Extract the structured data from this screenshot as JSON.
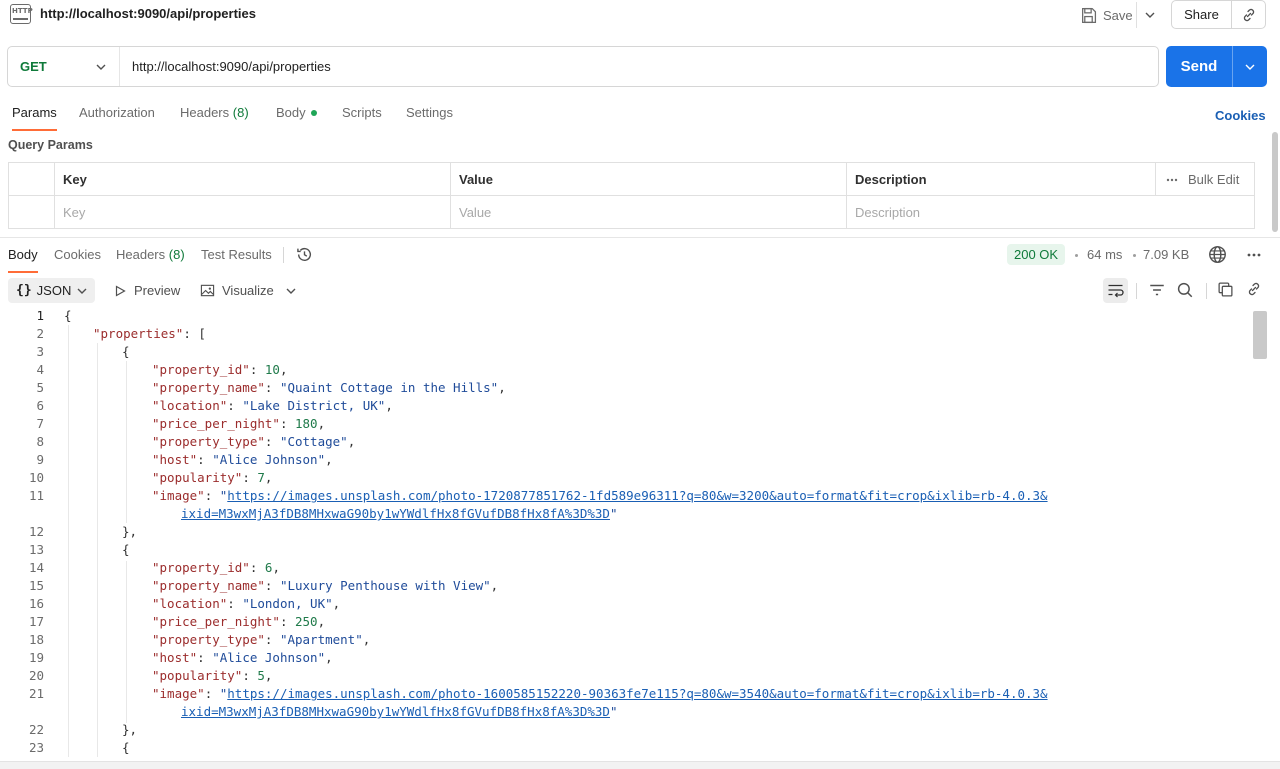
{
  "header": {
    "title": "http://localhost:9090/api/properties",
    "save_label": "Save",
    "share_label": "Share"
  },
  "request": {
    "method": "GET",
    "url": "http://localhost:9090/api/properties",
    "send_label": "Send"
  },
  "request_tabs": {
    "params": "Params",
    "authorization": "Authorization",
    "headers": "Headers",
    "headers_count": "(8)",
    "body": "Body",
    "scripts": "Scripts",
    "settings": "Settings",
    "cookies": "Cookies"
  },
  "query_params": {
    "title": "Query Params",
    "columns": {
      "key": "Key",
      "value": "Value",
      "description": "Description"
    },
    "bulk_edit": "Bulk Edit",
    "placeholders": {
      "key": "Key",
      "value": "Value",
      "description": "Description"
    }
  },
  "response_tabs": {
    "body": "Body",
    "cookies": "Cookies",
    "headers": "Headers",
    "headers_count": "(8)",
    "test_results": "Test Results"
  },
  "response_meta": {
    "status": "200 OK",
    "time": "64 ms",
    "size": "7.09 KB"
  },
  "view_bar": {
    "format": "JSON",
    "preview": "Preview",
    "visualize": "Visualize"
  },
  "code": {
    "line_numbers": [
      "1",
      "2",
      "3",
      "4",
      "5",
      "6",
      "7",
      "8",
      "9",
      "10",
      "11",
      "",
      "12",
      "13",
      "14",
      "15",
      "16",
      "17",
      "18",
      "19",
      "20",
      "21",
      "",
      "22",
      "23"
    ],
    "t1": "{",
    "t2k": "\"properties\"",
    "t2p": ": [",
    "t3": "{",
    "t4k": "\"property_id\"",
    "t4v": "10",
    "t5k": "\"property_name\"",
    "t5v": "\"Quaint Cottage in the Hills\"",
    "t6k": "\"location\"",
    "t6v": "\"Lake District, UK\"",
    "t7k": "\"price_per_night\"",
    "t7v": "180",
    "t8k": "\"property_type\"",
    "t8v": "\"Cottage\"",
    "t9k": "\"host\"",
    "t9v": "\"Alice Johnson\"",
    "t10k": "\"popularity\"",
    "t10v": "7",
    "t11k": "\"image\"",
    "t11v": "https://images.unsplash.com/photo-1720877851762-1fd589e96311?q=80&w=3200&auto=format&fit=crop&ixlib=rb-4.0.3&",
    "t11w": "ixid=M3wxMjA3fDB8MHxwaG90by1wYWdlfHx8fGVufDB8fHx8fA%3D%3D",
    "t12": "},",
    "t13": "{",
    "t14k": "\"property_id\"",
    "t14v": "6",
    "t15k": "\"property_name\"",
    "t15v": "\"Luxury Penthouse with View\"",
    "t16k": "\"location\"",
    "t16v": "\"London, UK\"",
    "t17k": "\"price_per_night\"",
    "t17v": "250",
    "t18k": "\"property_type\"",
    "t18v": "\"Apartment\"",
    "t19k": "\"host\"",
    "t19v": "\"Alice Johnson\"",
    "t20k": "\"popularity\"",
    "t20v": "5",
    "t21k": "\"image\"",
    "t21v": "https://images.unsplash.com/photo-1600585152220-90363fe7e115?q=80&w=3540&auto=format&fit=crop&ixlib=rb-4.0.3&",
    "t21w": "ixid=M3wxMjA3fDB8MHxwaG90by1wYWdlfHx8fGVufDB8fHx8fA%3D%3D",
    "t22": "},",
    "t23": "{"
  },
  "colors": {
    "accent": "#1a73e8",
    "tab_indicator": "#ff6c37",
    "method_get": "#0f7a3a",
    "status_ok_bg": "#e7f5ec"
  },
  "icons": {
    "request_type": "http-icon",
    "save": "save-icon",
    "share_link": "link-icon",
    "history": "history-icon",
    "globe": "globe-icon",
    "wrap": "wrap-lines-icon",
    "filter": "filter-icon",
    "search": "search-icon",
    "copy": "copy-icon",
    "link": "link-icon"
  }
}
